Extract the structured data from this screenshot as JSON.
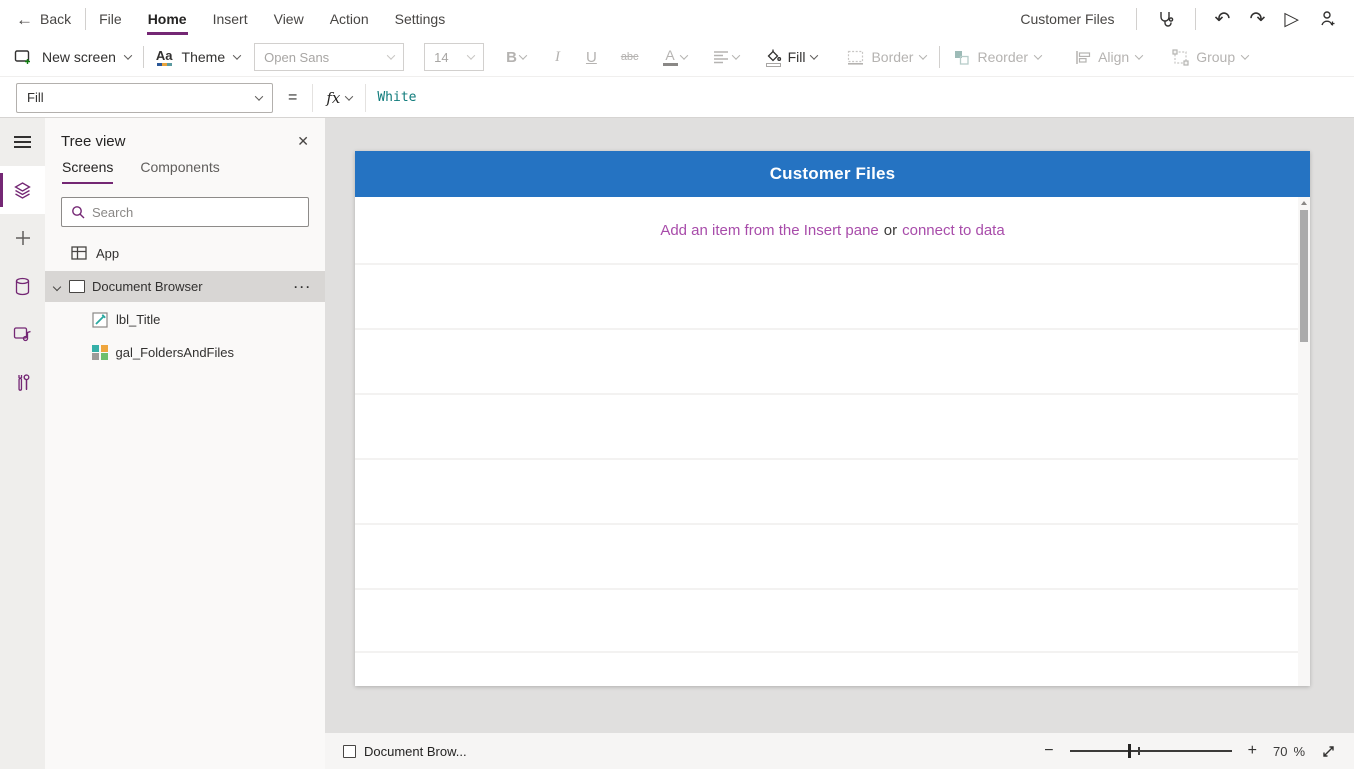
{
  "colors": {
    "accent_purple": "#742774",
    "screen_header_blue": "#2573c2",
    "placeholder_link_purple": "#a84caa",
    "formula_text_teal": "#0f7b7b",
    "canvas_background": "#e0dfde"
  },
  "menu_bar": {
    "back_glyph": "←",
    "back_label": "Back",
    "items": [
      {
        "label": "File"
      },
      {
        "label": "Home"
      },
      {
        "label": "Insert"
      },
      {
        "label": "View"
      },
      {
        "label": "Action"
      },
      {
        "label": "Settings"
      }
    ],
    "app_title": "Customer Files",
    "undo_glyph": "↶",
    "redo_glyph": "↷",
    "play_glyph": "▷"
  },
  "toolbar": {
    "new_screen_label": "New screen",
    "theme_glyph": "Aa",
    "theme_label": "Theme",
    "font_family_value": "Open Sans",
    "font_size_value": "14",
    "bold_glyph": "B",
    "italic_glyph": "I",
    "underline_glyph": "U",
    "strikethrough_glyph": "abc",
    "font_color_glyph": "A",
    "fill_label": "Fill",
    "border_label": "Border",
    "reorder_label": "Reorder",
    "align_label": "Align",
    "group_label": "Group"
  },
  "formula_bar": {
    "property_value": "Fill",
    "equals_glyph": "=",
    "fx_label": "fx",
    "formula_value": "White"
  },
  "tree_panel": {
    "title": "Tree view",
    "close_glyph": "✕",
    "tabs": [
      {
        "label": "Screens"
      },
      {
        "label": "Components"
      }
    ],
    "search_placeholder": "Search",
    "app_item_label": "App",
    "screen_item_label": "Document Browser",
    "screen_item_menu_glyph": "···",
    "children": [
      {
        "label": "lbl_Title"
      },
      {
        "label": "gal_FoldersAndFiles"
      }
    ]
  },
  "canvas": {
    "screen_header_title": "Customer Files",
    "placeholder_link_insert": "Add an item from the Insert pane",
    "placeholder_or": "or",
    "placeholder_link_data": "connect to data"
  },
  "status_bar": {
    "screen_label": "Document Brow...",
    "zoom_out_glyph": "−",
    "zoom_in_glyph": "+",
    "zoom_value": "70",
    "zoom_unit": "%"
  }
}
